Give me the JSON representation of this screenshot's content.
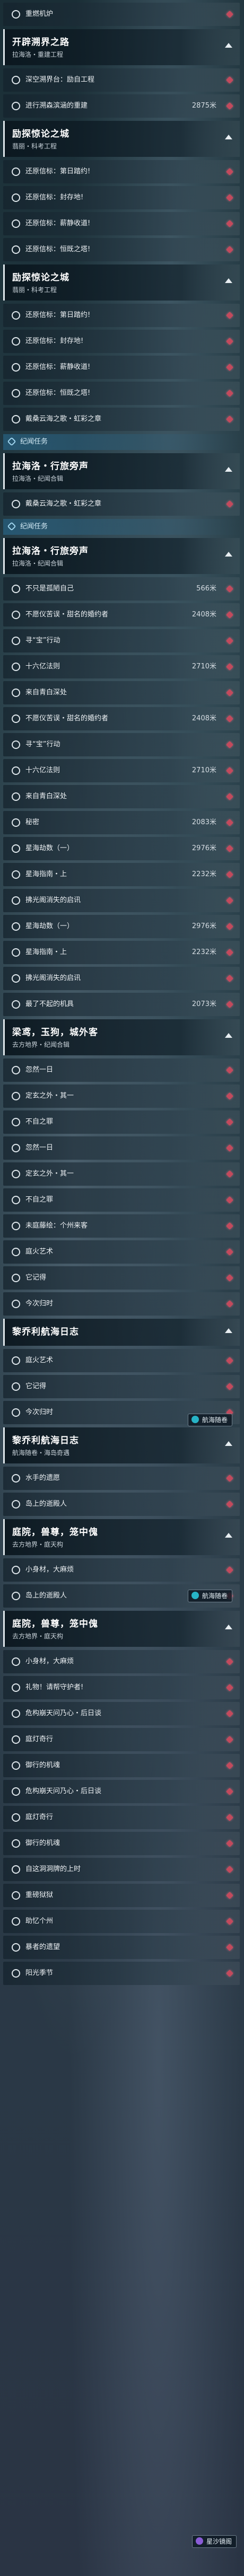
{
  "rows": [
    {
      "type": "item",
      "label": "重燃机炉",
      "dist": ""
    },
    {
      "type": "header",
      "title": "开辟溯界之路",
      "sub": "拉海洛・重建工程"
    },
    {
      "type": "item",
      "label": "深空溯界台：励自工程",
      "dist": ""
    },
    {
      "type": "item",
      "label": "进行溯森滨涵的重建",
      "dist": "2875米"
    },
    {
      "type": "header",
      "title": "励探惊论之城",
      "sub": "翡丽・科考工程"
    },
    {
      "type": "item",
      "label": "还原信标：第日踏约!",
      "dist": ""
    },
    {
      "type": "item",
      "label": "还原信标：封存地!",
      "dist": ""
    },
    {
      "type": "item",
      "label": "还原信标：薪静收道!",
      "dist": ""
    },
    {
      "type": "item",
      "label": "还原信标：恒既之塔!",
      "dist": ""
    },
    {
      "type": "header",
      "title": "励探惊论之城",
      "sub": "翡丽・科考工程"
    },
    {
      "type": "item",
      "label": "还原信标：第日踏约!",
      "dist": ""
    },
    {
      "type": "item",
      "label": "还原信标：封存地!",
      "dist": ""
    },
    {
      "type": "item",
      "label": "还原信标：薪静收道!",
      "dist": ""
    },
    {
      "type": "item",
      "label": "还原信标：恒既之塔!",
      "dist": ""
    },
    {
      "type": "item",
      "label": "戴桑云海之歌・虹彩之章",
      "dist": ""
    },
    {
      "type": "section",
      "label": "纪闻任务",
      "badge": ""
    },
    {
      "type": "header",
      "title": "拉海洛・行旅旁声",
      "sub": "拉海洛・纪闻合辑"
    },
    {
      "type": "item",
      "label": "戴桑云海之歌・虹彩之章",
      "dist": ""
    },
    {
      "type": "section",
      "label": "纪闻任务",
      "badge": ""
    },
    {
      "type": "header",
      "title": "拉海洛・行旅旁声",
      "sub": "拉海洛・纪闻合辑"
    },
    {
      "type": "item",
      "label": "不只是孤陋自己",
      "dist": "566米"
    },
    {
      "type": "item",
      "label": "不愿仪苦误・甜名的婚约者",
      "dist": "2408米"
    },
    {
      "type": "item",
      "label": "寻“宝”行动",
      "dist": ""
    },
    {
      "type": "item",
      "label": "十六亿法则",
      "dist": "2710米"
    },
    {
      "type": "item",
      "label": "来自青白深处",
      "dist": ""
    },
    {
      "type": "item",
      "label": "不愿仪苦误・甜名的婚约者",
      "dist": "2408米"
    },
    {
      "type": "item",
      "label": "寻“宝”行动",
      "dist": ""
    },
    {
      "type": "item",
      "label": "十六亿法则",
      "dist": "2710米"
    },
    {
      "type": "item",
      "label": "来自青白深处",
      "dist": ""
    },
    {
      "type": "item",
      "label": "秘密",
      "dist": "2083米"
    },
    {
      "type": "item",
      "label": "星海劫数（一）",
      "dist": "2976米"
    },
    {
      "type": "item",
      "label": "星海指南・上",
      "dist": "2232米"
    },
    {
      "type": "item",
      "label": "拂光阁消失的启讯",
      "dist": ""
    },
    {
      "type": "item",
      "label": "星海劫数（一）",
      "dist": "2976米"
    },
    {
      "type": "item",
      "label": "星海指南・上",
      "dist": "2232米"
    },
    {
      "type": "item",
      "label": "拂光阁消失的启讯",
      "dist": ""
    },
    {
      "type": "item",
      "label": "最了不起的机具",
      "dist": "2073米"
    },
    {
      "type": "header",
      "title": "梁鸢，玉狗，城外客",
      "sub": "去方地界・纪闻合辑"
    },
    {
      "type": "item",
      "label": "忽然一日",
      "dist": ""
    },
    {
      "type": "item",
      "label": "定玄之外・其一",
      "dist": ""
    },
    {
      "type": "item",
      "label": "不自之罪",
      "dist": ""
    },
    {
      "type": "item",
      "label": "忽然一日",
      "dist": ""
    },
    {
      "type": "item",
      "label": "定玄之外・其一",
      "dist": ""
    },
    {
      "type": "item",
      "label": "不自之罪",
      "dist": ""
    },
    {
      "type": "item",
      "label": "未庭藤绘：个州来客",
      "dist": ""
    },
    {
      "type": "item",
      "label": "庭火艺术",
      "dist": ""
    },
    {
      "type": "item",
      "label": "它记得",
      "dist": ""
    },
    {
      "type": "item",
      "label": "今次归时",
      "dist": ""
    },
    {
      "type": "header",
      "title": "黎乔利航海日志",
      "sub": ""
    },
    {
      "type": "item",
      "label": "庭火艺术",
      "dist": ""
    },
    {
      "type": "item",
      "label": "它记得",
      "dist": ""
    },
    {
      "type": "item",
      "label": "今次归时",
      "dist": ""
    },
    {
      "type": "header",
      "title": "黎乔利航海日志",
      "sub": "航海随卷・海岛奇遇",
      "overlay": "航海随卷",
      "overlay_style": "cyan"
    },
    {
      "type": "item",
      "label": "水手的遗愿",
      "dist": ""
    },
    {
      "type": "item",
      "label": "岛上的逝殿人",
      "dist": ""
    },
    {
      "type": "header",
      "title": "庭院，兽尊，笼中傀",
      "sub": "去方地界・庭天构"
    },
    {
      "type": "item",
      "label": "小身材，大麻烦",
      "dist": ""
    },
    {
      "type": "item",
      "label": "岛上的逝殿人",
      "dist": "",
      "overlay": "航海随卷",
      "overlay_style": "cyan"
    },
    {
      "type": "header",
      "title": "庭院，兽尊，笼中傀",
      "sub": "去方地界・庭天构"
    },
    {
      "type": "item",
      "label": "小身材，大麻烦",
      "dist": ""
    },
    {
      "type": "item",
      "label": "礼物！请帮守护者!",
      "dist": ""
    },
    {
      "type": "item",
      "label": "危构崩天问乃心・后日谈",
      "dist": ""
    },
    {
      "type": "item",
      "label": "庭灯奇行",
      "dist": ""
    },
    {
      "type": "item",
      "label": "御行的机魂",
      "dist": ""
    },
    {
      "type": "item",
      "label": "危构崩天问乃心・后日谈",
      "dist": ""
    },
    {
      "type": "item",
      "label": "庭灯奇行",
      "dist": ""
    },
    {
      "type": "item",
      "label": "御行的机魂",
      "dist": ""
    },
    {
      "type": "item",
      "label": "自这洞洞牌的上时",
      "dist": ""
    },
    {
      "type": "item",
      "label": "重磅狱狱",
      "dist": ""
    },
    {
      "type": "item",
      "label": "助忆个州",
      "dist": ""
    },
    {
      "type": "item",
      "label": "暴者的遗望",
      "dist": ""
    },
    {
      "type": "item",
      "label": "阳光季节",
      "dist": ""
    }
  ],
  "icons": {
    "bullet": "ring-icon",
    "track": "diamond-marker-icon",
    "collapse": "chevron-up-icon",
    "section": "diamond-tag-icon",
    "badge": "nav-badge-icon"
  },
  "overlays": [
    {
      "label": "航海随卷",
      "style": "cyan"
    },
    {
      "label": "航海随卷",
      "style": "cyan"
    },
    {
      "label": "星沙镜阁",
      "style": "purple"
    }
  ],
  "colors": {
    "accent": "#c24a5d",
    "section": "#2a7fa8",
    "text": "#eef2f5"
  }
}
